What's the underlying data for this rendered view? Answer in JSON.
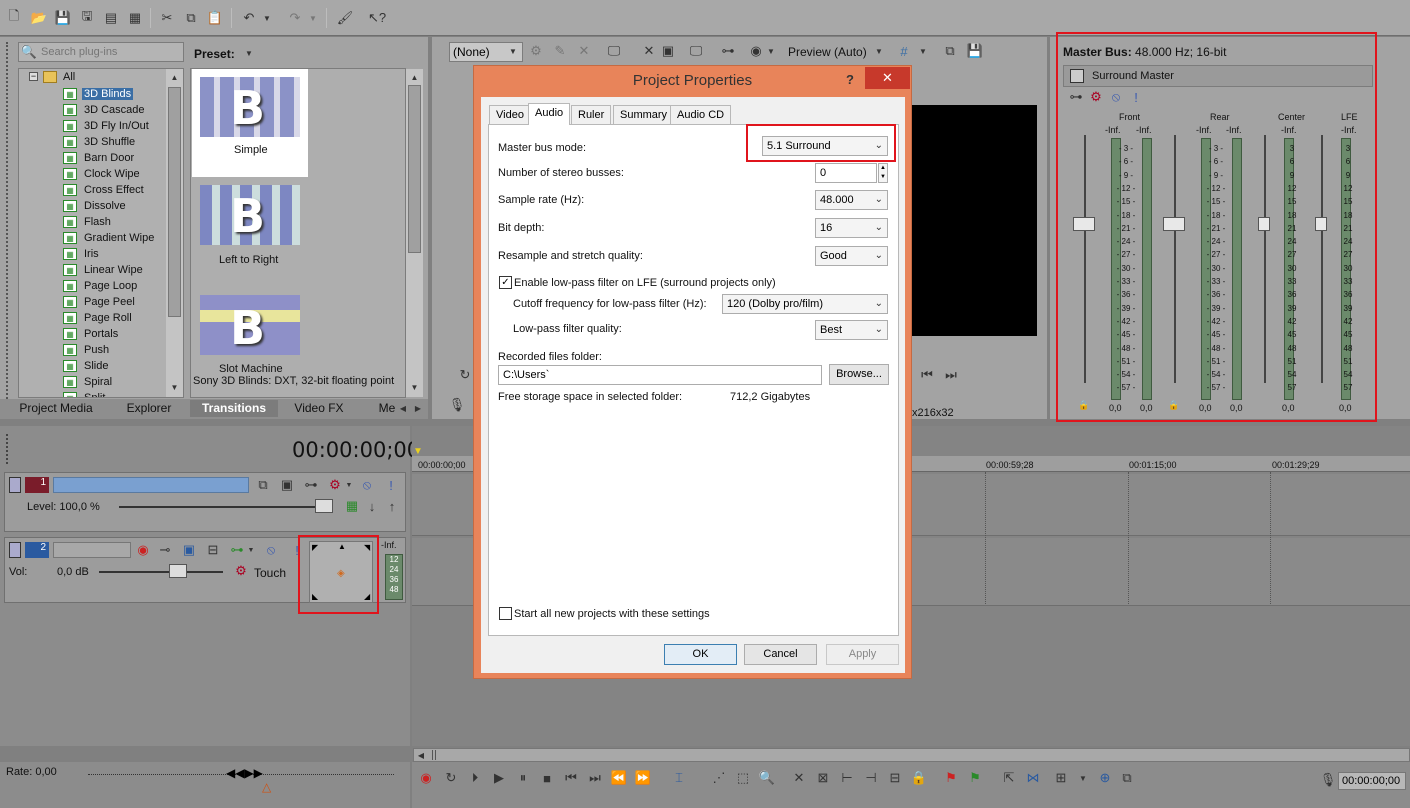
{
  "search": {
    "placeholder": "Search plug-ins"
  },
  "plugins": {
    "preset_label": "Preset:",
    "root": "All",
    "items": [
      "3D Blinds",
      "3D Cascade",
      "3D Fly In/Out",
      "3D Shuffle",
      "Barn Door",
      "Clock Wipe",
      "Cross Effect",
      "Dissolve",
      "Flash",
      "Gradient Wipe",
      "Iris",
      "Linear Wipe",
      "Page Loop",
      "Page Peel",
      "Page Roll",
      "Portals",
      "Push",
      "Slide",
      "Spiral",
      "Split"
    ],
    "presets": [
      "Simple",
      "Left to Right",
      "Slot Machine"
    ],
    "status": "Sony 3D Blinds: DXT, 32-bit floating point"
  },
  "bottom_tabs": [
    "Project Media",
    "Explorer",
    "Transitions",
    "Video FX",
    "Me"
  ],
  "preview": {
    "fx_select": "(None)",
    "mode": "Preview (Auto)",
    "info": "x216x32"
  },
  "master": {
    "title_bold": "Master Bus:",
    "title_rest": " 48.000 Hz; 16-bit",
    "name": "Surround Master",
    "channels": [
      "Front",
      "Rear",
      "Center",
      "LFE"
    ],
    "inf": "-Inf.",
    "scale": [
      "3",
      "6",
      "9",
      "12",
      "15",
      "18",
      "21",
      "24",
      "27",
      "30",
      "33",
      "36",
      "39",
      "42",
      "45",
      "48",
      "51",
      "54",
      "57"
    ],
    "scale_dashed": [
      "- 3 -",
      "- 6 -",
      "- 9 -",
      "- 12 -",
      "- 15 -",
      "- 18 -",
      "- 21 -",
      "- 24 -",
      "- 27 -",
      "- 30 -",
      "- 33 -",
      "- 36 -",
      "- 39 -",
      "- 42 -",
      "- 45 -",
      "- 48 -",
      "- 51 -",
      "- 54 -",
      "- 57 -"
    ],
    "zero": "0,0"
  },
  "timeline": {
    "timecode": "00:00:00;00",
    "ruler": [
      "00:00:00;00",
      "00:00:59;28",
      "00:01:15;00",
      "00:01:29;29"
    ],
    "track1": {
      "num": "1",
      "level": "Level: 100,0 %"
    },
    "track2": {
      "num": "2",
      "vol_label": "Vol:",
      "vol_value": "0,0 dB",
      "touch": "Touch",
      "inf": "-Inf.",
      "meter": [
        "12",
        "24",
        "36",
        "48"
      ]
    },
    "rate": "Rate: 0,00",
    "end_timecode": "00:00:00;00"
  },
  "dialog": {
    "title": "Project Properties",
    "help": "?",
    "close": "✕",
    "tabs": [
      "Video",
      "Audio",
      "Ruler",
      "Summary",
      "Audio CD"
    ],
    "active_tab": "Audio",
    "master_bus_mode_label": "Master bus mode:",
    "master_bus_mode_value": "5.1 Surround",
    "stereo_busses_label": "Number of stereo busses:",
    "stereo_busses_value": "0",
    "sample_rate_label": "Sample rate (Hz):",
    "sample_rate_value": "48.000",
    "bit_depth_label": "Bit depth:",
    "bit_depth_value": "16",
    "resample_label": "Resample and stretch quality:",
    "resample_value": "Good",
    "lowpass_enable_label": "Enable low-pass filter on LFE (surround projects only)",
    "cutoff_label": "Cutoff frequency for low-pass filter (Hz):",
    "cutoff_value": "120 (Dolby pro/film)",
    "lowpass_quality_label": "Low-pass filter quality:",
    "lowpass_quality_value": "Best",
    "recorded_folder_label": "Recorded files folder:",
    "recorded_folder_value": "C:\\Users`",
    "browse_label": "Browse...",
    "free_space_label": "Free storage space in selected folder:",
    "free_space_value": "712,2 Gigabytes",
    "start_new_label": "Start all new projects with these settings",
    "ok": "OK",
    "cancel": "Cancel",
    "apply": "Apply"
  },
  "colors": {
    "highlight": "#e0141c",
    "dialog_frame": "#e8845a",
    "selection": "#3a6ea5"
  }
}
